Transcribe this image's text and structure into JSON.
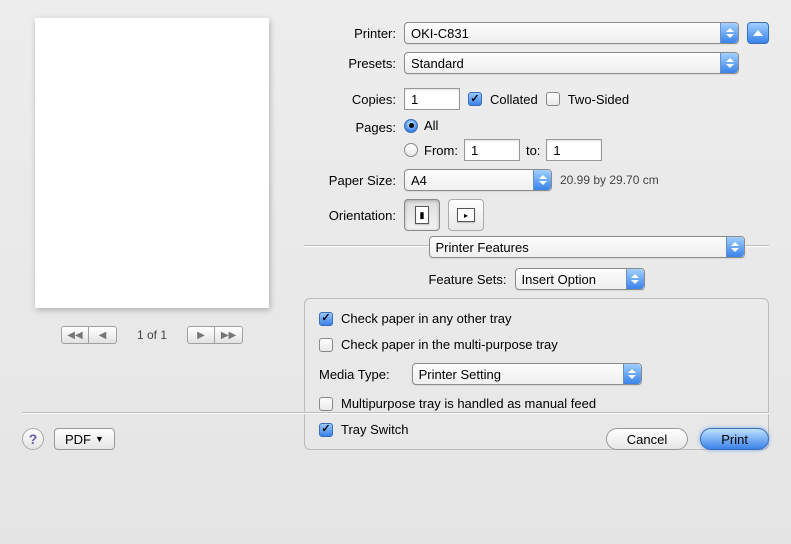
{
  "labels": {
    "printer": "Printer:",
    "presets": "Presets:",
    "copies": "Copies:",
    "pages": "Pages:",
    "paper_size": "Paper Size:",
    "orientation": "Orientation:",
    "feature_sets": "Feature Sets:",
    "media_type": "Media Type:",
    "to": "to:",
    "from": "From:"
  },
  "printer": {
    "value": "OKI-C831"
  },
  "presets": {
    "value": "Standard"
  },
  "copies": {
    "value": "1",
    "collated_label": "Collated",
    "two_sided_label": "Two-Sided"
  },
  "pages": {
    "all_label": "All",
    "from_value": "1",
    "to_value": "1"
  },
  "paper_size": {
    "value": "A4",
    "dimensions": "20.99 by 29.70 cm"
  },
  "section_select": {
    "value": "Printer Features"
  },
  "feature_sets": {
    "value": "Insert Option"
  },
  "features": {
    "check_other_tray": "Check paper in any other tray",
    "check_multipurpose": "Check paper in the multi-purpose tray",
    "media_type_value": "Printer Setting",
    "manual_feed": "Multipurpose tray is handled as manual feed",
    "tray_switch": "Tray Switch"
  },
  "preview": {
    "page_indicator": "1 of 1"
  },
  "buttons": {
    "pdf": "PDF",
    "cancel": "Cancel",
    "print": "Print"
  }
}
